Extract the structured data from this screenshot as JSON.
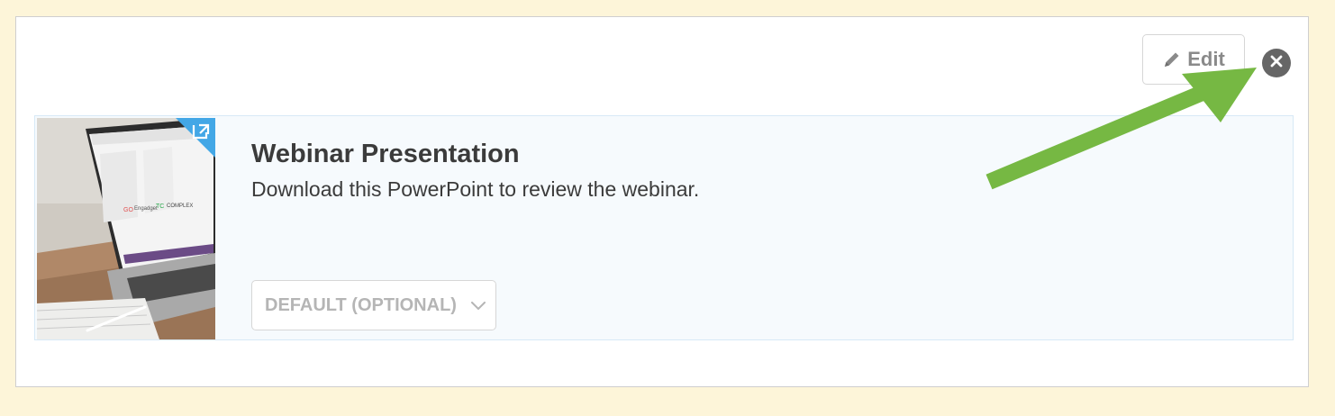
{
  "toolbar": {
    "edit_label": "Edit",
    "edit_icon": "pencil-icon",
    "close_icon": "close-circle-icon"
  },
  "resource": {
    "title": "Webinar Presentation",
    "description": "Download this PowerPoint to review the webinar.",
    "thumbnail": "laptop-photo",
    "external_link_icon": "external-link-icon"
  },
  "select": {
    "value": "DEFAULT (OPTIONAL)",
    "icon": "chevron-down-icon"
  },
  "annotation": {
    "arrow_color": "#76b843",
    "points_to": "close-button"
  },
  "colors": {
    "page_background": "#fdf5d9",
    "item_background": "#f6fafd",
    "accent_blue": "#43a7e6"
  }
}
